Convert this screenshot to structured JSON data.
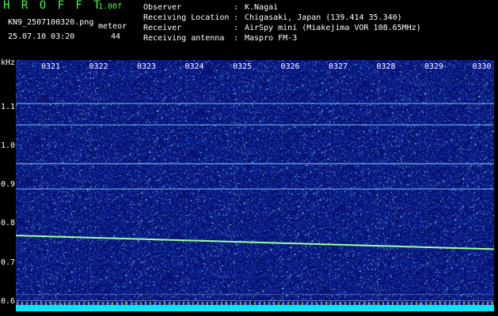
{
  "header": {
    "app_name": "H R O F F T",
    "version": "1.00f",
    "file_name": "KN9_2507100320.png",
    "mode_label": "meteor",
    "datetime": "25.07.10 03:20",
    "count": "44",
    "info": [
      {
        "label": "Observer",
        "value": "K.Nagai"
      },
      {
        "label": "Receiving Location",
        "value": "Chigasaki, Japan (139.414 35.340)"
      },
      {
        "label": "Receiver",
        "value": "AirSpy mini (Miakejima VOR 108.65MHz)"
      },
      {
        "label": "Receiving antenna",
        "value": "Maspro FM-3"
      }
    ]
  },
  "spectrogram": {
    "y_unit": "kHz",
    "y_ticks": [
      "1.1",
      "1.0",
      "0.9",
      "0.8",
      "0.7",
      "0.6"
    ],
    "y_tick_values": [
      1.1,
      1.0,
      0.9,
      0.8,
      0.7,
      0.6
    ],
    "y_range": [
      0.575,
      1.222
    ],
    "time_labels": [
      "0321",
      "0322",
      "0323",
      "0324",
      "0325",
      "0326",
      "0327",
      "0328",
      "0329",
      "0330"
    ],
    "horizontal_lines_khz": [
      1.11,
      1.055,
      0.955,
      0.89
    ],
    "drift_trace_khz": [
      0.77,
      0.735
    ],
    "colors": {
      "background": "#0a1a8a",
      "trace": "#9cff9c",
      "baseline": "#00e5ff",
      "text": "#ffffff",
      "accent": "#3cff3c"
    }
  }
}
